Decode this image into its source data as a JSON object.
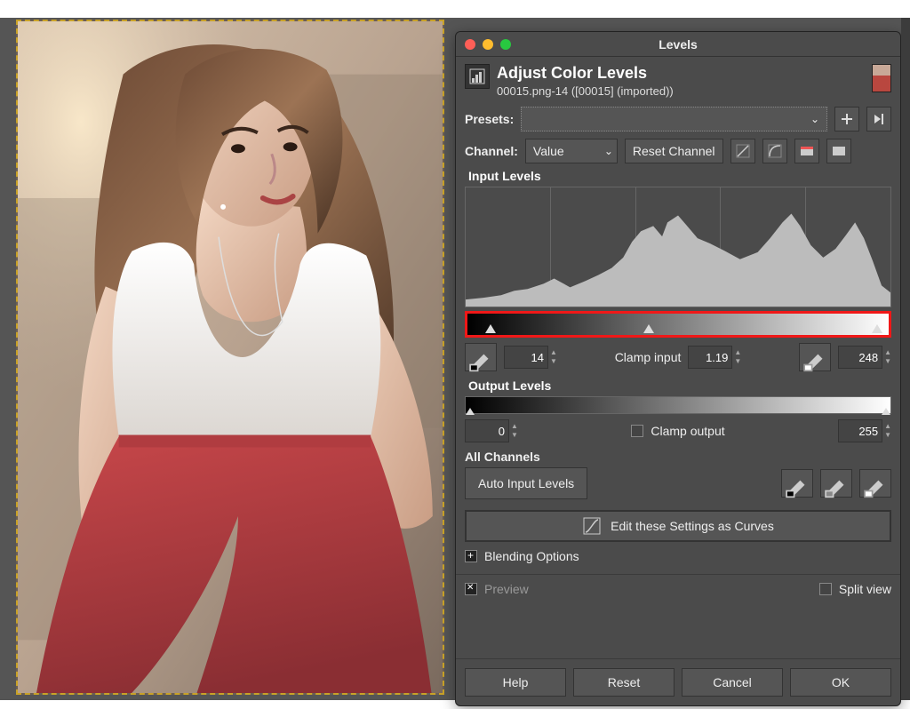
{
  "window": {
    "title": "Levels"
  },
  "header": {
    "title": "Adjust Color Levels",
    "subtitle": "00015.png-14 ([00015] (imported))"
  },
  "presets": {
    "label": "Presets:"
  },
  "channel": {
    "label": "Channel:",
    "value": "Value",
    "reset": "Reset Channel"
  },
  "input_levels": {
    "title": "Input Levels",
    "low": "14",
    "gamma": "1.19",
    "high": "248",
    "clamp_label": "Clamp input",
    "low_pct": 5.5,
    "mid_pct": 43,
    "high_pct": 97.3
  },
  "output_levels": {
    "title": "Output Levels",
    "low": "0",
    "high": "255",
    "clamp_label": "Clamp output"
  },
  "all_channels": {
    "title": "All Channels",
    "auto": "Auto Input Levels"
  },
  "curves": {
    "label": "Edit these Settings as Curves"
  },
  "blending": {
    "label": "Blending Options"
  },
  "preview": {
    "label": "Preview",
    "split": "Split view"
  },
  "buttons": {
    "help": "Help",
    "reset": "Reset",
    "cancel": "Cancel",
    "ok": "OK"
  }
}
